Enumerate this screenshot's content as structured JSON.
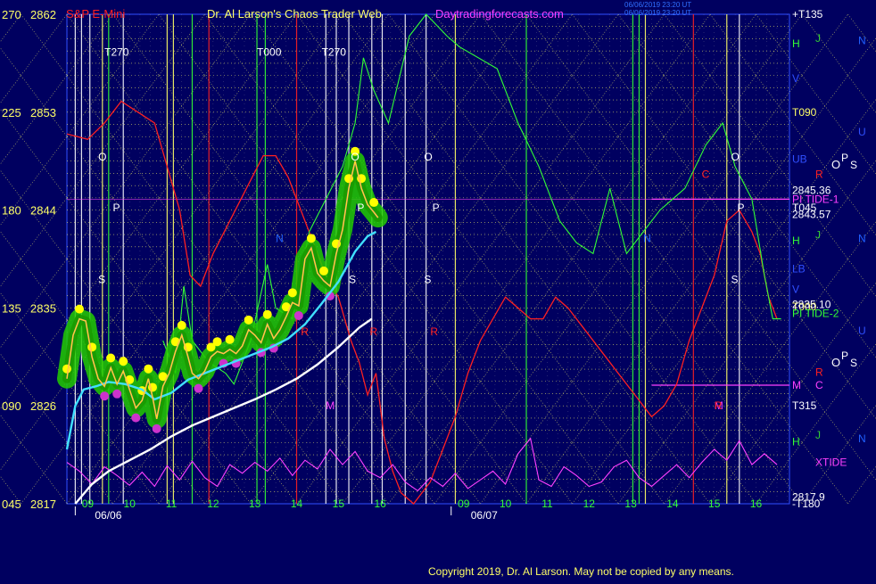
{
  "header": {
    "instrument": "S&P E-Mini",
    "title": "Dr. Al Larson's Chaos Trader Web",
    "site": "Daytradingforecasts.com",
    "stamp_line1": "06/06/2019 23:20 UT",
    "stamp_line2": "06/06/2019 23:20 UT"
  },
  "copyright": "Copyright 2019, Dr. Al Larson. May not be copied by any means.",
  "colors": {
    "background": "#000060",
    "grid_yellow": "#ffff66",
    "price_yellow": "#ffff00",
    "glow_green": "#22cc00",
    "flux_green": "#33ff33",
    "fast_ema": "#40e0ff",
    "slow_ema": "#ffffff",
    "red_field": "#ff2020",
    "tide_magenta": "#ff40ff",
    "label_blue": "#3050ff"
  },
  "chart_data": {
    "type": "line",
    "title": "S&P E-Mini",
    "xlabel": "",
    "ylabel": "",
    "ylim": [
      2817,
      2862
    ],
    "yticks_left_angle": [
      "270",
      "225",
      "180",
      "135",
      "090",
      "045"
    ],
    "yticks_left_price": [
      "2862",
      "2853",
      "2844",
      "2835",
      "2826",
      "2817"
    ],
    "yticks_values": [
      2862,
      2853,
      2844,
      2835,
      2826,
      2817
    ],
    "x_hour_labels": [
      {
        "t": 0.5,
        "label": "09"
      },
      {
        "t": 1.5,
        "label": "10"
      },
      {
        "t": 2.5,
        "label": "11"
      },
      {
        "t": 3.5,
        "label": "12"
      },
      {
        "t": 4.5,
        "label": "13"
      },
      {
        "t": 5.5,
        "label": "14"
      },
      {
        "t": 6.5,
        "label": "15"
      },
      {
        "t": 7.5,
        "label": "16"
      },
      {
        "t": 9.5,
        "label": "09"
      },
      {
        "t": 10.5,
        "label": "10"
      },
      {
        "t": 11.5,
        "label": "11"
      },
      {
        "t": 12.5,
        "label": "12"
      },
      {
        "t": 13.5,
        "label": "13"
      },
      {
        "t": 14.5,
        "label": "14"
      },
      {
        "t": 15.5,
        "label": "15"
      },
      {
        "t": 16.5,
        "label": "16"
      }
    ],
    "x_date_labels": [
      {
        "t": 0.2,
        "label": "06/06"
      },
      {
        "t": 9.2,
        "label": "06/07"
      }
    ],
    "xlim": [
      0,
      17.3
    ],
    "price_series": [
      [
        0.0,
        2828.5
      ],
      [
        0.15,
        2832.5
      ],
      [
        0.3,
        2834.0
      ],
      [
        0.45,
        2833.8
      ],
      [
        0.6,
        2830.5
      ],
      [
        0.75,
        2828.5
      ],
      [
        0.9,
        2827.8
      ],
      [
        1.05,
        2829.5
      ],
      [
        1.2,
        2828.0
      ],
      [
        1.35,
        2829.2
      ],
      [
        1.5,
        2827.5
      ],
      [
        1.65,
        2825.8
      ],
      [
        1.8,
        2826.5
      ],
      [
        1.95,
        2828.5
      ],
      [
        2.05,
        2826.8
      ],
      [
        2.15,
        2824.8
      ],
      [
        2.3,
        2827.8
      ],
      [
        2.45,
        2829.0
      ],
      [
        2.6,
        2831.0
      ],
      [
        2.75,
        2832.5
      ],
      [
        2.9,
        2830.5
      ],
      [
        3.0,
        2829.0
      ],
      [
        3.15,
        2828.5
      ],
      [
        3.3,
        2829.2
      ],
      [
        3.45,
        2830.5
      ],
      [
        3.6,
        2831.0
      ],
      [
        3.75,
        2830.8
      ],
      [
        3.9,
        2831.2
      ],
      [
        4.05,
        2830.8
      ],
      [
        4.2,
        2831.5
      ],
      [
        4.35,
        2833.0
      ],
      [
        4.5,
        2832.5
      ],
      [
        4.65,
        2831.8
      ],
      [
        4.8,
        2833.5
      ],
      [
        4.95,
        2832.2
      ],
      [
        5.1,
        2833.0
      ],
      [
        5.25,
        2834.2
      ],
      [
        5.4,
        2835.5
      ],
      [
        5.55,
        2835.2
      ],
      [
        5.7,
        2839.5
      ],
      [
        5.85,
        2840.5
      ],
      [
        6.0,
        2838.2
      ],
      [
        6.15,
        2837.5
      ],
      [
        6.3,
        2837.0
      ],
      [
        6.45,
        2840.0
      ],
      [
        6.6,
        2842.2
      ],
      [
        6.75,
        2846.0
      ],
      [
        6.9,
        2848.5
      ],
      [
        7.05,
        2846.0
      ],
      [
        7.2,
        2844.5
      ],
      [
        7.35,
        2843.8
      ],
      [
        7.45,
        2843.3
      ]
    ],
    "fast_ema": [
      [
        0.0,
        2822.0
      ],
      [
        0.2,
        2826.0
      ],
      [
        0.4,
        2827.5
      ],
      [
        0.7,
        2827.8
      ],
      [
        1.0,
        2828.2
      ],
      [
        1.4,
        2828.0
      ],
      [
        1.8,
        2827.5
      ],
      [
        2.1,
        2826.6
      ],
      [
        2.5,
        2827.2
      ],
      [
        2.9,
        2828.4
      ],
      [
        3.3,
        2829.0
      ],
      [
        3.7,
        2829.6
      ],
      [
        4.1,
        2830.2
      ],
      [
        4.5,
        2830.8
      ],
      [
        4.9,
        2831.4
      ],
      [
        5.3,
        2832.2
      ],
      [
        5.7,
        2833.5
      ],
      [
        6.1,
        2835.4
      ],
      [
        6.5,
        2837.4
      ],
      [
        6.9,
        2840.2
      ],
      [
        7.2,
        2841.6
      ],
      [
        7.4,
        2842.0
      ]
    ],
    "slow_ema": [
      [
        0.2,
        2817.0
      ],
      [
        0.6,
        2818.8
      ],
      [
        1.0,
        2820.0
      ],
      [
        1.5,
        2821.0
      ],
      [
        2.0,
        2822.0
      ],
      [
        2.5,
        2823.2
      ],
      [
        3.0,
        2824.2
      ],
      [
        3.5,
        2825.0
      ],
      [
        4.0,
        2825.8
      ],
      [
        4.5,
        2826.6
      ],
      [
        5.0,
        2827.5
      ],
      [
        5.5,
        2828.5
      ],
      [
        6.0,
        2829.8
      ],
      [
        6.5,
        2831.4
      ],
      [
        7.0,
        2833.2
      ],
      [
        7.3,
        2834.0
      ]
    ],
    "green_flux": [
      [
        2.3,
        2832
      ],
      [
        2.6,
        2829
      ],
      [
        2.8,
        2837
      ],
      [
        3.0,
        2832
      ],
      [
        3.4,
        2830
      ],
      [
        3.8,
        2829
      ],
      [
        4.0,
        2828
      ],
      [
        4.4,
        2832
      ],
      [
        4.8,
        2839
      ],
      [
        5.0,
        2835
      ],
      [
        5.4,
        2834
      ],
      [
        5.8,
        2842
      ],
      [
        6.2,
        2845
      ],
      [
        6.6,
        2848
      ],
      [
        6.9,
        2852
      ],
      [
        7.1,
        2858
      ],
      [
        7.35,
        2855
      ],
      [
        7.7,
        2852
      ],
      [
        8.2,
        2860
      ],
      [
        8.6,
        2862
      ],
      [
        9.1,
        2860
      ],
      [
        9.4,
        2859
      ],
      [
        10.3,
        2857
      ],
      [
        10.8,
        2852
      ],
      [
        11.3,
        2848
      ],
      [
        11.8,
        2843
      ],
      [
        12.2,
        2841
      ],
      [
        12.6,
        2840
      ],
      [
        13.0,
        2846
      ],
      [
        13.4,
        2840
      ],
      [
        13.8,
        2842
      ],
      [
        14.2,
        2844
      ],
      [
        14.8,
        2846
      ],
      [
        15.3,
        2850
      ],
      [
        15.7,
        2852
      ],
      [
        16.0,
        2848
      ],
      [
        16.4,
        2845
      ],
      [
        16.7,
        2838
      ],
      [
        16.9,
        2834
      ],
      [
        17.1,
        2834
      ]
    ],
    "red_field": [
      [
        0.0,
        2851
      ],
      [
        0.5,
        2850.5
      ],
      [
        0.9,
        2852
      ],
      [
        1.3,
        2854
      ],
      [
        1.7,
        2853
      ],
      [
        2.1,
        2852
      ],
      [
        2.4,
        2848
      ],
      [
        2.7,
        2844
      ],
      [
        2.95,
        2838
      ],
      [
        3.2,
        2837
      ],
      [
        3.5,
        2840
      ],
      [
        3.9,
        2843
      ],
      [
        4.3,
        2846
      ],
      [
        4.7,
        2849
      ],
      [
        5.0,
        2849
      ],
      [
        5.3,
        2847
      ],
      [
        5.6,
        2844
      ],
      [
        5.9,
        2841
      ],
      [
        6.2,
        2838
      ],
      [
        6.5,
        2836
      ],
      [
        6.8,
        2832
      ],
      [
        7.0,
        2830
      ],
      [
        7.2,
        2827
      ],
      [
        7.4,
        2829
      ],
      [
        7.6,
        2823
      ],
      [
        7.8,
        2820
      ],
      [
        8.0,
        2818
      ],
      [
        8.3,
        2817
      ],
      [
        8.7,
        2819
      ],
      [
        9.0,
        2822
      ],
      [
        9.3,
        2825
      ],
      [
        9.6,
        2829
      ],
      [
        9.9,
        2832
      ],
      [
        10.2,
        2834
      ],
      [
        10.5,
        2836
      ],
      [
        10.8,
        2835
      ],
      [
        11.1,
        2834
      ],
      [
        11.4,
        2834
      ],
      [
        11.7,
        2836
      ],
      [
        12.0,
        2835
      ],
      [
        12.4,
        2833
      ],
      [
        12.8,
        2831
      ],
      [
        13.2,
        2829
      ],
      [
        13.6,
        2827
      ],
      [
        14.0,
        2825
      ],
      [
        14.3,
        2826
      ],
      [
        14.6,
        2828
      ],
      [
        14.9,
        2832
      ],
      [
        15.2,
        2835
      ],
      [
        15.5,
        2838
      ],
      [
        15.8,
        2843
      ],
      [
        16.1,
        2844
      ],
      [
        16.4,
        2842
      ],
      [
        16.6,
        2840
      ],
      [
        16.8,
        2836
      ],
      [
        17.0,
        2834
      ]
    ],
    "tide_magenta": [
      [
        0.0,
        2820.8
      ],
      [
        0.3,
        2820.0
      ],
      [
        0.6,
        2818.8
      ],
      [
        0.9,
        2820.4
      ],
      [
        1.2,
        2819.6
      ],
      [
        1.5,
        2818.7
      ],
      [
        1.8,
        2819.9
      ],
      [
        2.1,
        2818.6
      ],
      [
        2.4,
        2820.5
      ],
      [
        2.7,
        2819.2
      ],
      [
        3.0,
        2820.9
      ],
      [
        3.3,
        2819.4
      ],
      [
        3.6,
        2818.6
      ],
      [
        3.9,
        2820.6
      ],
      [
        4.2,
        2819.8
      ],
      [
        4.5,
        2820.8
      ],
      [
        4.8,
        2820.0
      ],
      [
        5.1,
        2821.2
      ],
      [
        5.4,
        2819.6
      ],
      [
        5.7,
        2821.0
      ],
      [
        6.0,
        2820.2
      ],
      [
        6.3,
        2822.0
      ],
      [
        6.6,
        2820.6
      ],
      [
        6.9,
        2821.8
      ],
      [
        7.2,
        2820.0
      ],
      [
        7.5,
        2819.4
      ],
      [
        7.8,
        2820.6
      ],
      [
        8.1,
        2819.0
      ],
      [
        8.4,
        2818.2
      ],
      [
        8.7,
        2819.4
      ],
      [
        9.0,
        2818.6
      ],
      [
        9.3,
        2819.8
      ],
      [
        9.6,
        2818.4
      ],
      [
        9.9,
        2819.2
      ],
      [
        10.2,
        2820.0
      ],
      [
        10.5,
        2818.8
      ],
      [
        10.8,
        2821.6
      ],
      [
        11.1,
        2823.0
      ],
      [
        11.3,
        2819.2
      ],
      [
        11.6,
        2818.6
      ],
      [
        11.9,
        2820.4
      ],
      [
        12.2,
        2819.6
      ],
      [
        12.5,
        2818.6
      ],
      [
        12.8,
        2819.0
      ],
      [
        13.1,
        2820.4
      ],
      [
        13.4,
        2821.0
      ],
      [
        13.7,
        2819.4
      ],
      [
        14.0,
        2818.6
      ],
      [
        14.3,
        2819.6
      ],
      [
        14.6,
        2820.6
      ],
      [
        14.9,
        2819.4
      ],
      [
        15.2,
        2820.8
      ],
      [
        15.5,
        2822.0
      ],
      [
        15.8,
        2821.0
      ],
      [
        16.1,
        2822.8
      ],
      [
        16.4,
        2820.6
      ],
      [
        16.7,
        2821.6
      ],
      [
        17.0,
        2820.6
      ]
    ],
    "t_markers": [
      {
        "t": 0.9,
        "label": "T270",
        "level": 2858.5
      },
      {
        "t": 4.55,
        "label": "T000",
        "level": 2858.5
      },
      {
        "t": 6.1,
        "label": "T270",
        "level": 2858.5
      }
    ],
    "right_labels": [
      {
        "label": "+T135",
        "level": 2862.0,
        "color": "#ffffff"
      },
      {
        "label": "H",
        "level": 2859.3,
        "color": "#33ff33"
      },
      {
        "label": "J",
        "level": 2859.8,
        "color": "#33cc33",
        "col": 1
      },
      {
        "label": "N",
        "level": 2859.6,
        "color": "#2060ff",
        "col": 2
      },
      {
        "label": "V",
        "level": 2856.1,
        "color": "#3050ff"
      },
      {
        "label": "T090",
        "level": 2853.0,
        "color": "#ffff66"
      },
      {
        "label": "U",
        "level": 2851.2,
        "color": "#3050ff",
        "col": 2
      },
      {
        "label": "UB",
        "level": 2848.7,
        "color": "#3050ff"
      },
      {
        "label": "R",
        "level": 2847.3,
        "color": "#ff2020",
        "col": 1
      },
      {
        "label": "2845.36",
        "level": 2845.8,
        "color": "#ffffff"
      },
      {
        "label": "PI TIDE-1",
        "level": 2845.0,
        "color": "#ff40ff"
      },
      {
        "label": "T045",
        "level": 2844.2,
        "color": "#ffffff"
      },
      {
        "label": "2843.57",
        "level": 2843.6,
        "color": "#ffffff"
      },
      {
        "label": "H",
        "level": 2841.2,
        "color": "#33ff33"
      },
      {
        "label": "J",
        "level": 2841.7,
        "color": "#33cc33",
        "col": 1
      },
      {
        "label": "N",
        "level": 2841.4,
        "color": "#2060ff",
        "col": 2
      },
      {
        "label": "LB",
        "level": 2838.6,
        "color": "#3050ff"
      },
      {
        "label": "V",
        "level": 2836.7,
        "color": "#3050ff"
      },
      {
        "label": "T000",
        "level": 2835.1,
        "color": "#ffff66"
      },
      {
        "label": "PI TIDE-2",
        "level": 2834.5,
        "color": "#33ff33"
      },
      {
        "label": "U",
        "level": 2832.9,
        "color": "#3050ff",
        "col": 2
      },
      {
        "label": "R",
        "level": 2829.1,
        "color": "#ff2020",
        "col": 1
      },
      {
        "label": "M",
        "level": 2827.9,
        "color": "#ff40ff"
      },
      {
        "label": "C",
        "level": 2827.9,
        "color": "#ff40ff",
        "col": 1
      },
      {
        "label": "T315",
        "level": 2826.0,
        "color": "#ffffff"
      },
      {
        "label": "H",
        "level": 2822.7,
        "color": "#33ff33"
      },
      {
        "label": "J",
        "level": 2823.3,
        "color": "#33cc33",
        "col": 1
      },
      {
        "label": "N",
        "level": 2823.0,
        "color": "#2060ff",
        "col": 2
      },
      {
        "label": "XTIDE",
        "level": 2820.8,
        "color": "#ff40ff",
        "col": 1
      },
      {
        "label": "-T180",
        "level": 2817.0,
        "color": "#ffffff"
      }
    ],
    "in_chart_letters": [
      {
        "label": "O",
        "t": 0.75,
        "level": 2848.9,
        "color": "#ffffff"
      },
      {
        "label": "P",
        "t": 1.1,
        "level": 2844.2,
        "color": "#ffffff"
      },
      {
        "label": "S",
        "t": 0.75,
        "level": 2837.6,
        "color": "#ffffff"
      },
      {
        "label": "O",
        "t": 6.8,
        "level": 2848.9,
        "color": "#ffffff"
      },
      {
        "label": "P",
        "t": 6.95,
        "level": 2844.2,
        "color": "#ffffff"
      },
      {
        "label": "S",
        "t": 6.75,
        "level": 2837.6,
        "color": "#ffffff"
      },
      {
        "label": "O",
        "t": 8.55,
        "level": 2848.9,
        "color": "#ffffff"
      },
      {
        "label": "P",
        "t": 8.75,
        "level": 2844.2,
        "color": "#ffffff"
      },
      {
        "label": "S",
        "t": 8.55,
        "level": 2837.6,
        "color": "#ffffff"
      },
      {
        "label": "O",
        "t": 15.9,
        "level": 2848.9,
        "color": "#ffffff"
      },
      {
        "label": "P",
        "t": 16.05,
        "level": 2844.2,
        "color": "#ffffff"
      },
      {
        "label": "S",
        "t": 15.9,
        "level": 2837.6,
        "color": "#ffffff"
      },
      {
        "label": "N",
        "t": 5.0,
        "level": 2841.4,
        "color": "#2060ff"
      },
      {
        "label": "N",
        "t": 13.8,
        "level": 2841.4,
        "color": "#2060ff"
      },
      {
        "label": "R",
        "t": 5.6,
        "level": 2832.8,
        "color": "#ff2020"
      },
      {
        "label": "R",
        "t": 7.25,
        "level": 2832.8,
        "color": "#ff2020"
      },
      {
        "label": "R",
        "t": 8.7,
        "level": 2832.8,
        "color": "#ff2020"
      },
      {
        "label": "C",
        "t": 15.2,
        "level": 2847.3,
        "color": "#ff2020"
      },
      {
        "label": "M",
        "t": 6.2,
        "level": 2826.0,
        "color": "#ff40ff"
      },
      {
        "label": "M",
        "t": 15.5,
        "level": 2826.0,
        "color": "#ff40ff"
      },
      {
        "label": "R",
        "t": 15.5,
        "level": 2826.0,
        "color": "#ff2020"
      }
    ],
    "right_price_text": [
      {
        "label": "2835.10",
        "level": 2835.3,
        "color": "#ffffff"
      },
      {
        "label": "2817.9",
        "level": 2817.6,
        "color": "#ffffff"
      }
    ],
    "ops_groups": [
      {
        "level": 2848.3,
        "color": "#ffffff"
      },
      {
        "level": 2830.1,
        "color": "#ffffff"
      }
    ]
  }
}
